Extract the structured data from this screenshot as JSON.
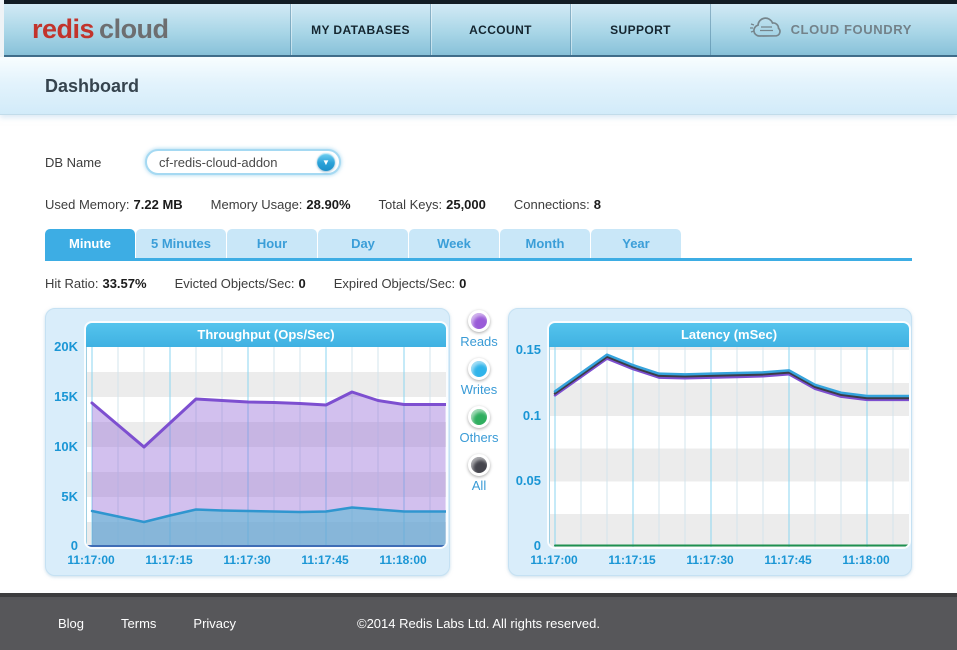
{
  "header": {
    "logo_redis": "redis",
    "logo_cloud": "cloud",
    "nav": [
      {
        "label": "MY DATABASES"
      },
      {
        "label": "ACCOUNT"
      },
      {
        "label": "SUPPORT"
      }
    ],
    "partner": {
      "label": "CLOUD FOUNDRY"
    }
  },
  "page_title": "Dashboard",
  "db_selector": {
    "label": "DB Name",
    "value": "cf-redis-cloud-addon"
  },
  "stats": [
    {
      "label": "Used Memory:",
      "value": "7.22 MB"
    },
    {
      "label": "Memory Usage:",
      "value": "28.90%"
    },
    {
      "label": "Total Keys:",
      "value": "25,000"
    },
    {
      "label": "Connections:",
      "value": "8"
    }
  ],
  "tabs": [
    {
      "label": "Minute",
      "active": true
    },
    {
      "label": "5 Minutes",
      "active": false
    },
    {
      "label": "Hour",
      "active": false
    },
    {
      "label": "Day",
      "active": false
    },
    {
      "label": "Week",
      "active": false
    },
    {
      "label": "Month",
      "active": false
    },
    {
      "label": "Year",
      "active": false
    }
  ],
  "sub_stats": [
    {
      "label": "Hit Ratio:",
      "value": "33.57%"
    },
    {
      "label": "Evicted Objects/Sec:",
      "value": "0"
    },
    {
      "label": "Expired Objects/Sec:",
      "value": "0"
    }
  ],
  "legend": [
    {
      "label": "Reads",
      "color": "#9a5bd8"
    },
    {
      "label": "Writes",
      "color": "#30b4ea"
    },
    {
      "label": "Others",
      "color": "#2fae5f"
    },
    {
      "label": "All",
      "color": "#45454d"
    }
  ],
  "chart_data": [
    {
      "type": "area",
      "title": "Throughput (Ops/Sec)",
      "x_seconds": [
        0,
        5,
        10,
        15,
        20,
        25,
        30,
        35,
        40,
        45,
        50,
        55,
        60,
        65,
        68
      ],
      "x_ticks": [
        {
          "label": "11:17:00",
          "seconds": 0
        },
        {
          "label": "11:17:15",
          "seconds": 15
        },
        {
          "label": "11:17:30",
          "seconds": 30
        },
        {
          "label": "11:17:45",
          "seconds": 45
        },
        {
          "label": "11:18:00",
          "seconds": 60
        }
      ],
      "ylim": [
        0,
        20000
      ],
      "y_ticks": [
        {
          "label": "20K",
          "value": 20000
        },
        {
          "label": "15K",
          "value": 15000
        },
        {
          "label": "10K",
          "value": 10000
        },
        {
          "label": "5K",
          "value": 5000
        },
        {
          "label": "0",
          "value": 0
        }
      ],
      "grid": {
        "minor": "#d3e5ed",
        "major": "#8bd6f0"
      },
      "baseline_color": "#3f6db6",
      "series": [
        {
          "name": "Reads",
          "color": "#7d4fd0",
          "width": 3,
          "fill": "rgba(148,106,214,0.42)",
          "values": [
            14400,
            12200,
            10000,
            12400,
            14800,
            14650,
            14500,
            14450,
            14350,
            14200,
            15500,
            14650,
            14250,
            14250,
            14250
          ]
        },
        {
          "name": "Writes",
          "color": "#2f96cf",
          "width": 2.5,
          "fill": "rgba(82,183,209,0.55)",
          "values": [
            3600,
            3050,
            2500,
            3150,
            3750,
            3650,
            3600,
            3550,
            3500,
            3550,
            3950,
            3750,
            3550,
            3550,
            3550
          ]
        }
      ]
    },
    {
      "type": "line",
      "title": "Latency (mSec)",
      "x_seconds": [
        0,
        5,
        10,
        15,
        20,
        25,
        30,
        35,
        40,
        45,
        50,
        55,
        60,
        65,
        68
      ],
      "x_ticks": [
        {
          "label": "11:17:00",
          "seconds": 0
        },
        {
          "label": "11:17:15",
          "seconds": 15
        },
        {
          "label": "11:17:30",
          "seconds": 30
        },
        {
          "label": "11:17:45",
          "seconds": 45
        },
        {
          "label": "11:18:00",
          "seconds": 60
        }
      ],
      "ylim": [
        0,
        0.1523
      ],
      "y_ticks": [
        {
          "label": "0.15",
          "value": 0.15
        },
        {
          "label": "0.1",
          "value": 0.1
        },
        {
          "label": "0.05",
          "value": 0.05
        },
        {
          "label": "0",
          "value": 0
        }
      ],
      "grid": {
        "minor": "#d3e5ed",
        "major": "#8bd6f0"
      },
      "series": [
        {
          "name": "Reads",
          "color": "#7d4fd0",
          "width": 2.5,
          "values": [
            0.1155,
            0.1295,
            0.1435,
            0.1355,
            0.129,
            0.1285,
            0.129,
            0.1295,
            0.13,
            0.1315,
            0.1205,
            0.1145,
            0.112,
            0.112,
            0.112
          ]
        },
        {
          "name": "All",
          "color": "#3c3c46",
          "width": 2.5,
          "values": [
            0.117,
            0.131,
            0.145,
            0.137,
            0.1305,
            0.13,
            0.1305,
            0.131,
            0.1315,
            0.133,
            0.122,
            0.116,
            0.1135,
            0.1135,
            0.1135
          ]
        },
        {
          "name": "Writes",
          "color": "#35a3dc",
          "width": 2.5,
          "values": [
            0.1185,
            0.1325,
            0.1465,
            0.1385,
            0.132,
            0.1315,
            0.132,
            0.1325,
            0.133,
            0.1345,
            0.1235,
            0.1175,
            0.115,
            0.115,
            0.115
          ]
        },
        {
          "name": "Others",
          "color": "#1f9150",
          "width": 2,
          "values": [
            0,
            0,
            0,
            0,
            0,
            0,
            0,
            0,
            0,
            0,
            0,
            0,
            0,
            0,
            0
          ]
        }
      ]
    }
  ],
  "footer": {
    "links": [
      {
        "label": "Blog"
      },
      {
        "label": "Terms"
      },
      {
        "label": "Privacy"
      }
    ],
    "copyright": "©2014 Redis Labs Ltd. All rights reserved."
  }
}
